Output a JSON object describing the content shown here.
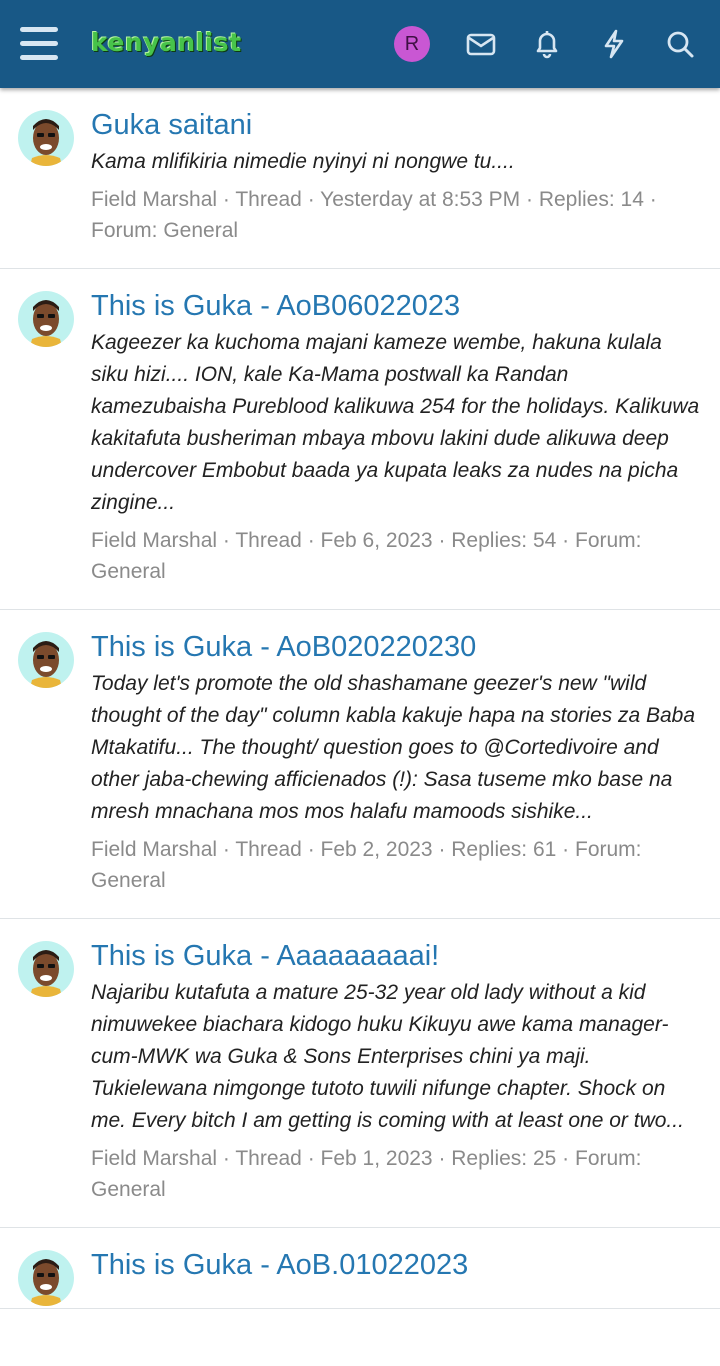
{
  "header": {
    "logo_text": "kenyanlist",
    "user_initial": "R",
    "icons": [
      "menu-icon",
      "envelope-icon",
      "bell-icon",
      "bolt-icon",
      "search-icon"
    ],
    "colors": {
      "bar": "#185886",
      "logo": "#47c34a",
      "avatar": "#c957d3",
      "title": "#2577b1"
    }
  },
  "results": [
    {
      "title": "Guka saitani",
      "snippet": "Kama mlifikiria nimedie nyinyi ni nongwe tu....",
      "meta": "Field Marshal · Thread · Yesterday at 8:53 PM · Replies: 14 · Forum: General"
    },
    {
      "title": "This is Guka - AoB06022023",
      "snippet": "Kageezer ka kuchoma majani kameze wembe, hakuna kulala siku hizi.... ION, kale Ka-Mama postwall ka Randan kamezubaisha Pureblood kalikuwa 254 for the holidays. Kalikuwa kakitafuta busheriman mbaya mbovu lakini dude alikuwa deep undercover Embobut baada ya kupata leaks za nudes na picha zingine...",
      "meta": "Field Marshal · Thread · Feb 6, 2023 · Replies: 54 · Forum: General"
    },
    {
      "title": "This is Guka - AoB020220230",
      "snippet": "Today let's promote the old shashamane geezer's new \"wild thought of the day\" column kabla kakuje hapa na stories za Baba Mtakatifu... The thought/ question goes to @Cortedivoire and other jaba-chewing afficienados (!): Sasa tuseme mko base na mresh mnachana mos mos halafu mamoods sishike...",
      "meta": "Field Marshal · Thread · Feb 2, 2023 · Replies: 61 · Forum: General"
    },
    {
      "title": "This is Guka - Aaaaaaaaai!",
      "snippet": "Najaribu kutafuta a mature 25-32 year old lady without a kid nimuwekee biachara kidogo huku Kikuyu awe kama manager-cum-MWK wa Guka & Sons Enterprises chini ya maji. Tukielewana nimgonge tutoto tuwili nifunge chapter. Shock on me. Every bitch I am getting is coming with at least one or two...",
      "meta": "Field Marshal · Thread · Feb 1, 2023 · Replies: 25 · Forum: General"
    },
    {
      "title": "This is Guka - AoB.01022023",
      "snippet": "",
      "meta": ""
    }
  ]
}
